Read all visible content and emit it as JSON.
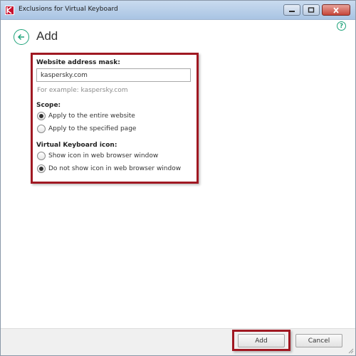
{
  "window": {
    "title": "Exclusions for Virtual Keyboard"
  },
  "header": {
    "title": "Add"
  },
  "form": {
    "mask_label": "Website address mask:",
    "mask_value": "kaspersky.com",
    "mask_hint": "For example: kaspersky.com",
    "scope_label": "Scope:",
    "scope_options": [
      {
        "label": "Apply to the entire website",
        "selected": true
      },
      {
        "label": "Apply to the specified page",
        "selected": false
      }
    ],
    "icon_label": "Virtual Keyboard icon:",
    "icon_options": [
      {
        "label": "Show icon in web browser window",
        "selected": false
      },
      {
        "label": "Do not show icon in web browser window",
        "selected": true
      }
    ]
  },
  "footer": {
    "add_label": "Add",
    "cancel_label": "Cancel"
  },
  "colors": {
    "accent": "#1fa37a",
    "highlight": "#a01822"
  }
}
